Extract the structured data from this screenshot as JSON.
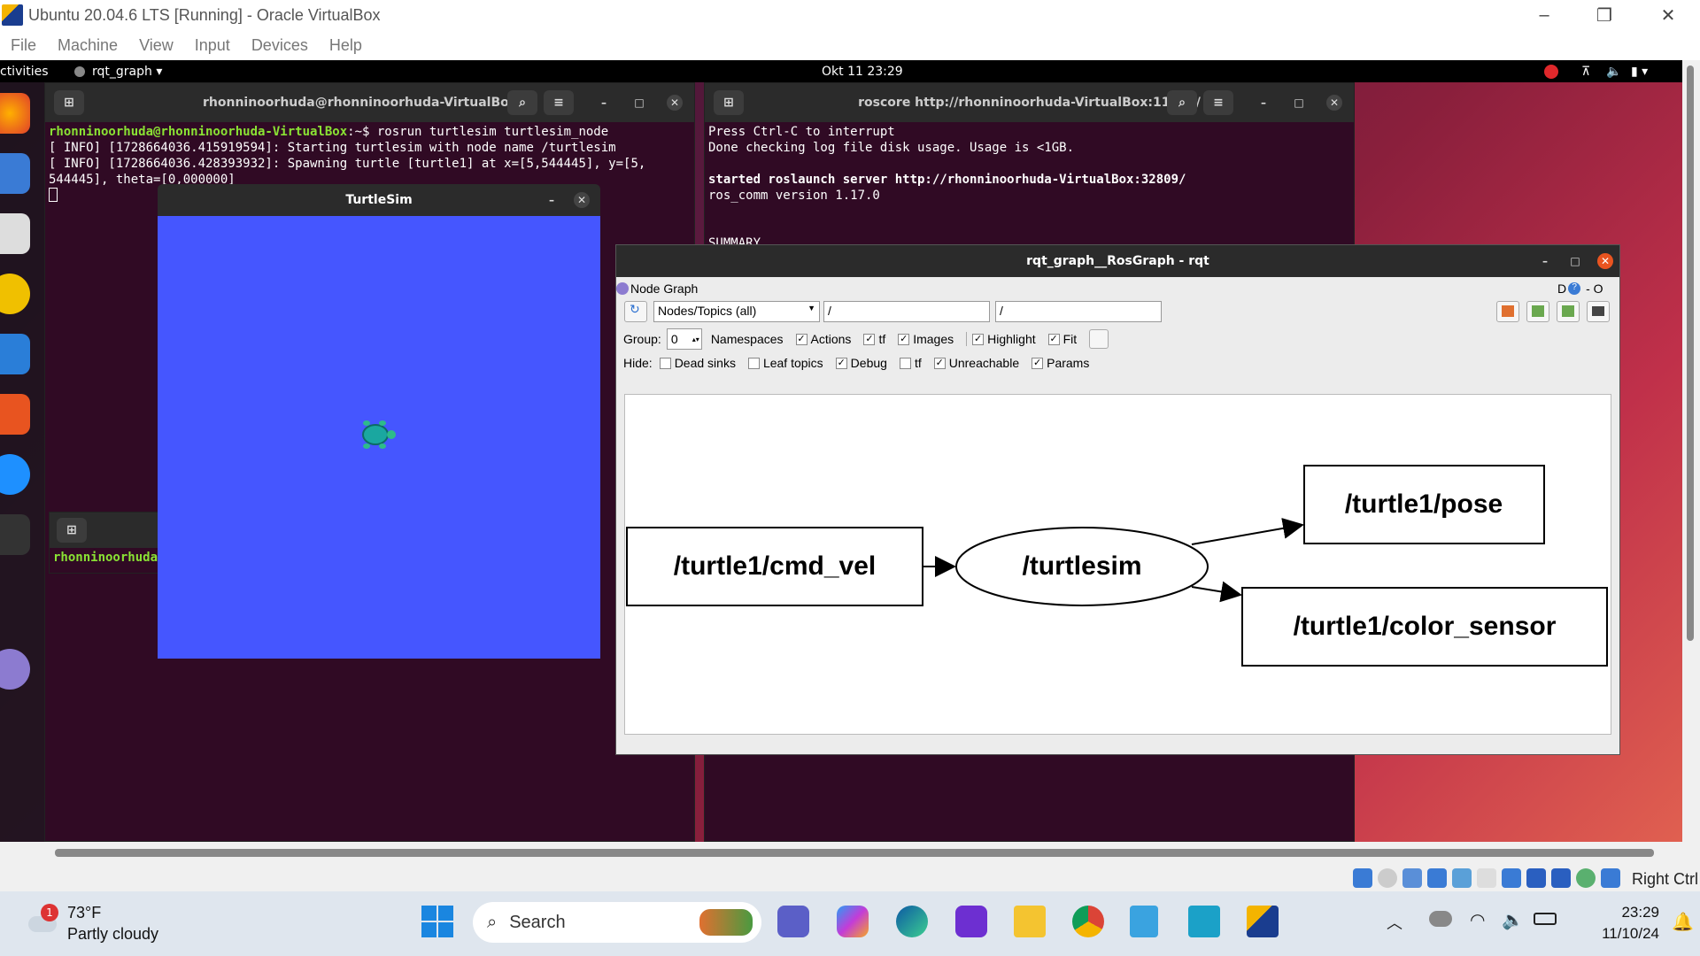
{
  "vbox": {
    "title": "Ubuntu 20.04.6 LTS [Running] - Oracle VirtualBox",
    "menu": [
      "File",
      "Machine",
      "View",
      "Input",
      "Devices",
      "Help"
    ],
    "status_right": "Right Ctrl"
  },
  "ubuntu": {
    "activities": "ctivities",
    "app_menu": "rqt_graph ▾",
    "clock": "Okt 11  23:29"
  },
  "term1": {
    "title": "rhonninoorhuda@rhonninoorhuda-VirtualBox: ~",
    "prompt": "rhonninoorhuda@rhonninoorhuda-VirtualBox",
    "command": ":~$ rosrun turtlesim turtlesim_node",
    "line2": "[ INFO] [1728664036.415919594]: Starting turtlesim with node name /turtlesim",
    "line3": "[ INFO] [1728664036.428393932]: Spawning turtle [turtle1] at x=[5,544445], y=[5,",
    "line4": "544445], theta=[0,000000]"
  },
  "term2": {
    "title": "roscore http://rhonninoorhuda-VirtualBox:11311/",
    "line1": "Press Ctrl-C to interrupt",
    "line2": "Done checking log file disk usage. Usage is <1GB.",
    "line3": "started roslaunch server http://rhonninoorhuda-VirtualBox:32809/",
    "line4": "ros_comm version 1.17.0",
    "line5": "SUMMARY"
  },
  "term3": {
    "prompt": "rhonninoorhuda"
  },
  "turtlesim": {
    "title": "TurtleSim"
  },
  "rqt": {
    "title": "rqt_graph__RosGraph - rqt",
    "plugin": "Node Graph",
    "plugin_right": "D",
    "plugin_right2": "- O",
    "mode": "Nodes/Topics (all)",
    "filter1": "/",
    "filter2": "/",
    "group_label": "Group:",
    "group_value": "0",
    "opts": {
      "namespaces": "Namespaces",
      "actions": "Actions",
      "tf": "tf",
      "images": "Images",
      "highlight": "Highlight",
      "fit": "Fit"
    },
    "hide_label": "Hide:",
    "hide": {
      "dead_sinks": "Dead sinks",
      "leaf_topics": "Leaf topics",
      "debug": "Debug",
      "tf": "tf",
      "unreachable": "Unreachable",
      "params": "Params"
    },
    "checked": "✓",
    "graph": {
      "topic_cmd": "/turtle1/cmd_vel",
      "node": "/turtlesim",
      "topic_pose": "/turtle1/pose",
      "topic_color": "/turtle1/color_sensor"
    }
  },
  "taskbar": {
    "weather_temp": "73°F",
    "weather_desc": "Partly cloudy",
    "weather_badge": "1",
    "search": "Search",
    "time": "23:29",
    "date": "11/10/24"
  }
}
